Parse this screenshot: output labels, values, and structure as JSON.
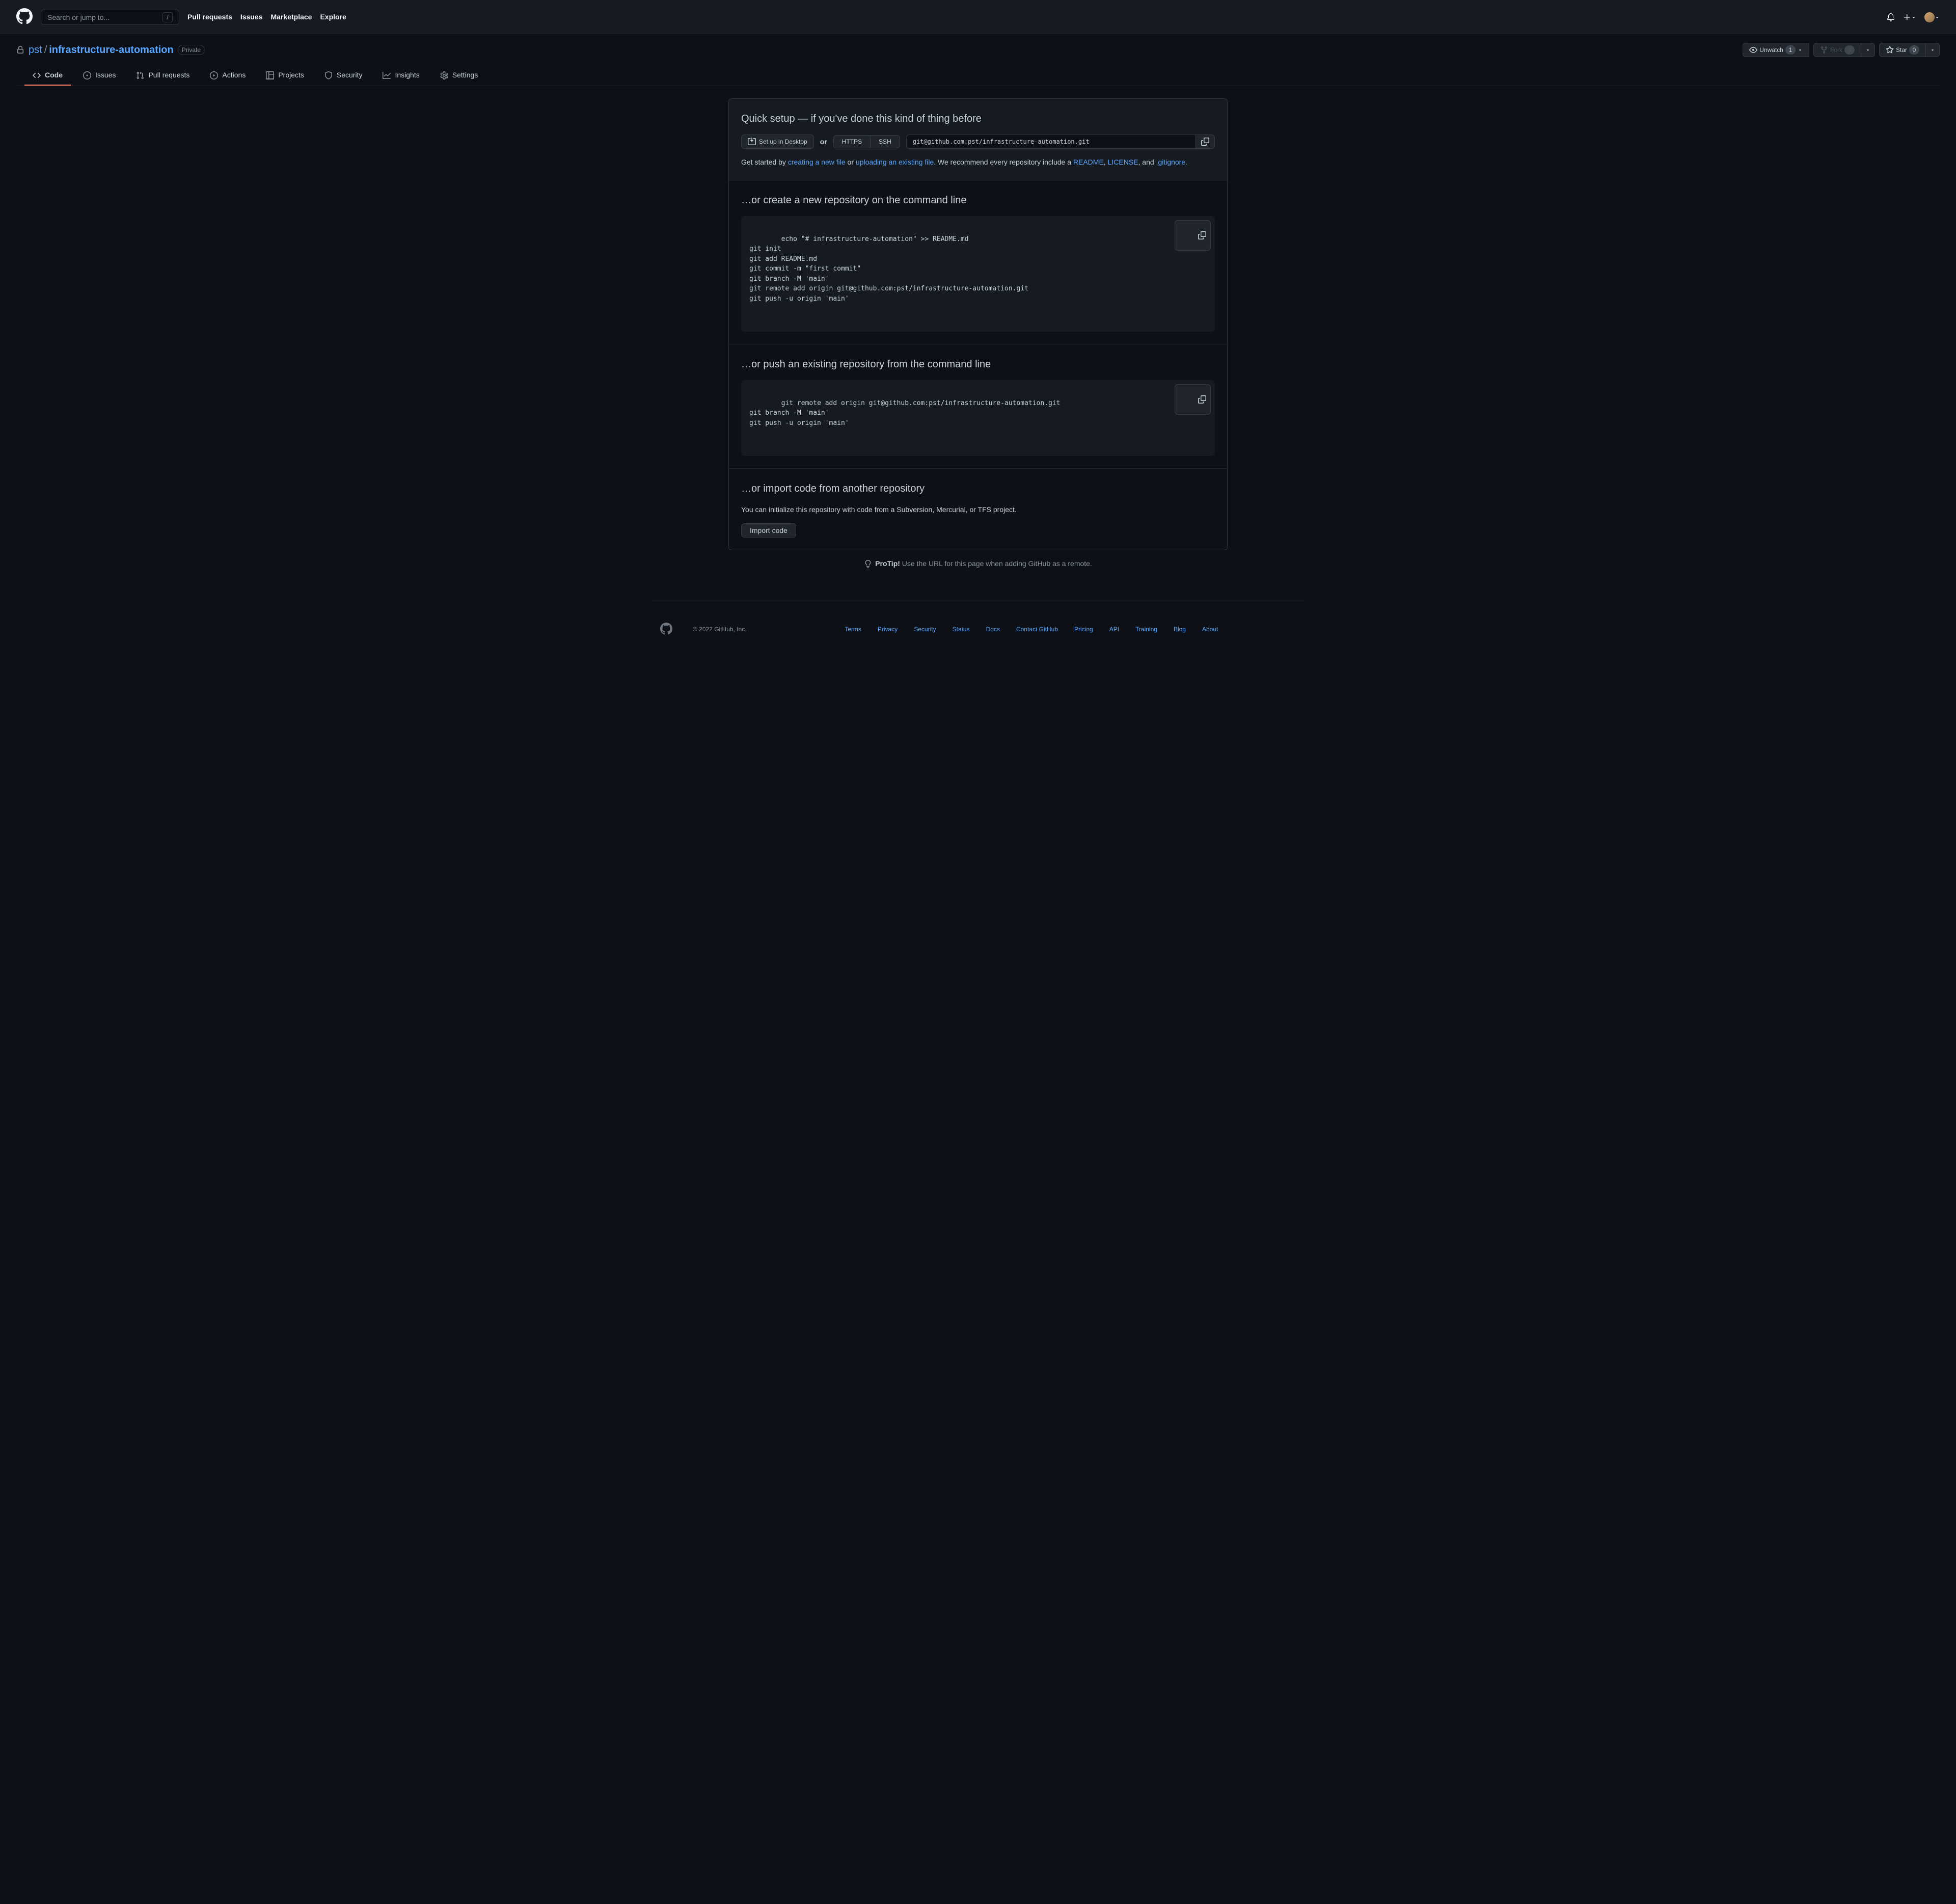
{
  "header": {
    "search_placeholder": "Search or jump to...",
    "slash": "/",
    "nav": {
      "pull_requests": "Pull requests",
      "issues": "Issues",
      "marketplace": "Marketplace",
      "explore": "Explore"
    }
  },
  "repo": {
    "owner": "pst",
    "name": "infrastructure-automation",
    "visibility": "Private",
    "watch_label": "Unwatch",
    "watch_count": "1",
    "fork_label": "Fork",
    "fork_count": "0",
    "star_label": "Star",
    "star_count": "0"
  },
  "tabs": {
    "code": "Code",
    "issues": "Issues",
    "pull_requests": "Pull requests",
    "actions": "Actions",
    "projects": "Projects",
    "security": "Security",
    "insights": "Insights",
    "settings": "Settings"
  },
  "quick": {
    "heading": "Quick setup — if you've done this kind of thing before",
    "desktop": "Set up in Desktop",
    "or": "or",
    "https": "HTTPS",
    "ssh": "SSH",
    "url": "git@github.com:pst/infrastructure-automation.git",
    "help_prefix": "Get started by ",
    "create_link": "creating a new file",
    "help_or": " or ",
    "upload_link": "uploading an existing file",
    "help_mid": ". We recommend every repository include a ",
    "readme": "README",
    "comma1": ", ",
    "license": "LICENSE",
    "and": ", and ",
    "gitignore": ".gitignore",
    "period": "."
  },
  "create": {
    "heading": "…or create a new repository on the command line",
    "code": "echo \"# infrastructure-automation\" >> README.md\ngit init\ngit add README.md\ngit commit -m \"first commit\"\ngit branch -M 'main'\ngit remote add origin git@github.com:pst/infrastructure-automation.git\ngit push -u origin 'main'"
  },
  "push": {
    "heading": "…or push an existing repository from the command line",
    "code": "git remote add origin git@github.com:pst/infrastructure-automation.git\ngit branch -M 'main'\ngit push -u origin 'main'"
  },
  "import": {
    "heading": "…or import code from another repository",
    "desc": "You can initialize this repository with code from a Subversion, Mercurial, or TFS project.",
    "button": "Import code"
  },
  "protip": {
    "label": "ProTip!",
    "text": " Use the URL for this page when adding GitHub as a remote."
  },
  "footer": {
    "copyright": "© 2022 GitHub, Inc.",
    "links": {
      "terms": "Terms",
      "privacy": "Privacy",
      "security": "Security",
      "status": "Status",
      "docs": "Docs",
      "contact": "Contact GitHub",
      "pricing": "Pricing",
      "api": "API",
      "training": "Training",
      "blog": "Blog",
      "about": "About"
    }
  }
}
